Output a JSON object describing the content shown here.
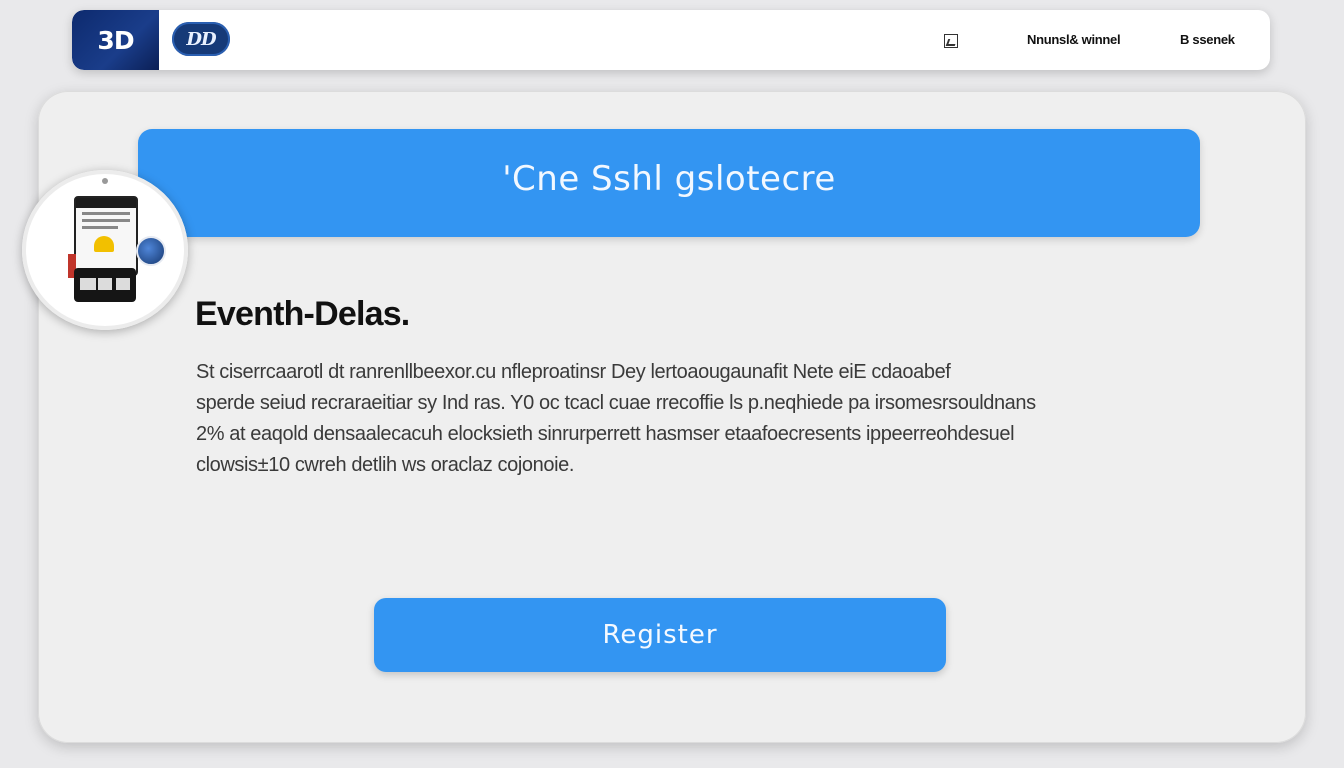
{
  "header": {
    "logo_primary": "3D",
    "logo_secondary": "DD",
    "icon": "image-icon",
    "links": [
      "Nnunsl& winnel",
      "B ssenek"
    ]
  },
  "banner": {
    "title": "'Cne Sshl gslotecre"
  },
  "event": {
    "title": "Eventh-Delas.",
    "description_lines": [
      "St ciserrcaarotl dt ranrenllbeexor.cu nfleproatinsr  Dey lertoaougaunafit  Nete eiE cdaoabef",
      "sperde seiud recraraeitiar sy Ind ras. Y0 oc tcacl cuae rrecoffie ls p.neqhiede pa irsomesrsouldnans",
      "2% at eaqold densaalecacuh elocksieth sinrurperrett hasmser etaafoecresents ippeerreohdesuel",
      "clowsis±10  cwreh detlih ws oraclaz cojonoie."
    ]
  },
  "actions": {
    "register_label": "Register"
  },
  "colors": {
    "accent": "#3395f2",
    "navy": "#0d2a6e",
    "background": "#e9e9eb",
    "card": "#efefef"
  },
  "illustration": {
    "icon": "event-calendar-illustration-icon"
  }
}
